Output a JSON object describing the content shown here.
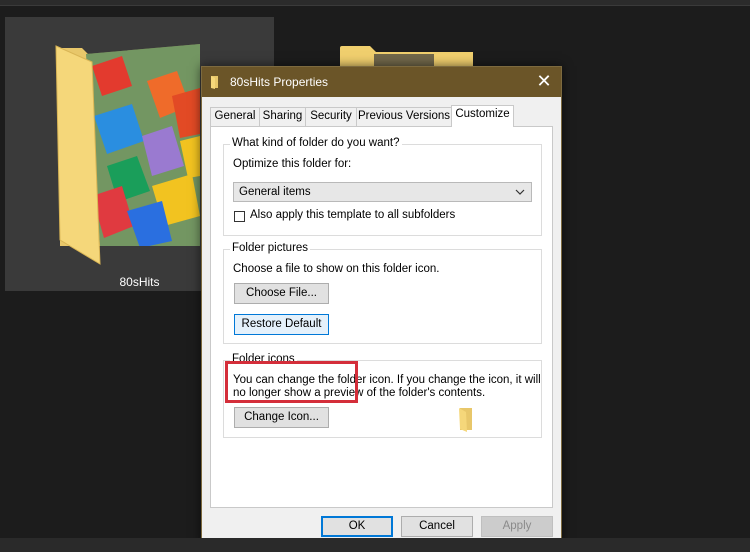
{
  "desktop": {
    "folder_label": "80sHits"
  },
  "dialog": {
    "title": "80sHits Properties",
    "close_glyph": "✕",
    "tabs": [
      {
        "label": "General"
      },
      {
        "label": "Sharing"
      },
      {
        "label": "Security"
      },
      {
        "label": "Previous Versions"
      },
      {
        "label": "Customize",
        "active": true
      }
    ],
    "folder_type": {
      "heading": "What kind of folder do you want?",
      "optimize_label": "Optimize this folder for:",
      "selected_option": "General items",
      "subfolders_checkbox_label": "Also apply this template to all subfolders"
    },
    "folder_pictures": {
      "heading": "Folder pictures",
      "description": "Choose a file to show on this folder icon.",
      "choose_file_label": "Choose File...",
      "restore_default_label": "Restore Default"
    },
    "folder_icons": {
      "heading": "Folder icons",
      "description_line1": "You can change the folder icon. If you change the icon, it will",
      "description_line2": "no longer show a preview of the folder's contents.",
      "change_icon_label": "Change Icon..."
    },
    "buttons": {
      "ok_label": "OK",
      "cancel_label": "Cancel",
      "apply_label": "Apply"
    }
  },
  "colors": {
    "titlebar": "#6b5528",
    "highlight": "#d42e3a",
    "focus": "#0078d7"
  }
}
